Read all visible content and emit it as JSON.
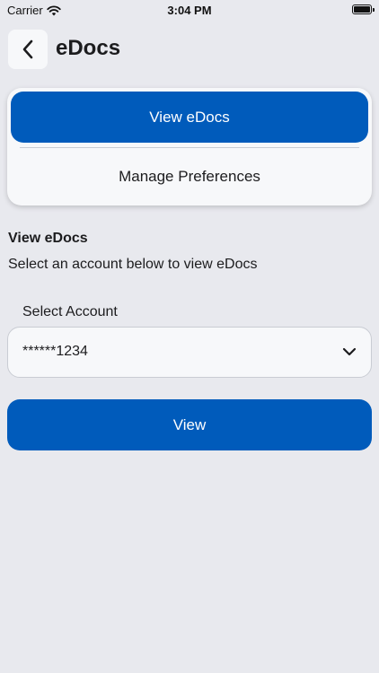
{
  "status_bar": {
    "carrier": "Carrier",
    "time": "3:04 PM",
    "icons": [
      "wifi-icon",
      "battery-icon"
    ]
  },
  "header": {
    "back_icon": "chevron-left-icon",
    "title": "eDocs"
  },
  "segments": {
    "active_label": "View eDocs",
    "inactive_label": "Manage Preferences"
  },
  "section": {
    "heading": "View eDocs",
    "description": "Select an account below to view eDocs"
  },
  "account_field": {
    "label": "Select Account",
    "value": "******1234",
    "icon": "chevron-down-icon"
  },
  "primary_action": {
    "label": "View"
  },
  "colors": {
    "background": "#E8E9EE",
    "surface": "#F7F8FA",
    "accent": "#005BBB",
    "text": "#1C1C1E"
  }
}
